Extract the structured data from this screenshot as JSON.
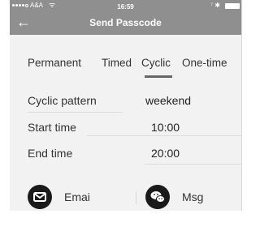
{
  "status_bar": {
    "carrier": "A&A",
    "time": "16:59",
    "bluetooth": "⁷ ✱"
  },
  "nav": {
    "back_icon": "back-arrow-icon",
    "title": "Send Passcode"
  },
  "tabs": [
    {
      "label": "Permanent"
    },
    {
      "label": "Timed"
    },
    {
      "label": "Cyclic",
      "selected": true
    },
    {
      "label": "One-time"
    }
  ],
  "form": {
    "cyclic_pattern": {
      "label": "Cyclic pattern",
      "value": "weekend"
    },
    "start_time": {
      "label": "Start time",
      "value": "10:00"
    },
    "end_time": {
      "label": "End time",
      "value": "20:00"
    }
  },
  "share": {
    "email_label": "Emai",
    "msg_label": "Msg"
  },
  "colors": {
    "header": "#8f8f8f",
    "background": "#f2f2f2",
    "icon": "#1a1a1a"
  }
}
